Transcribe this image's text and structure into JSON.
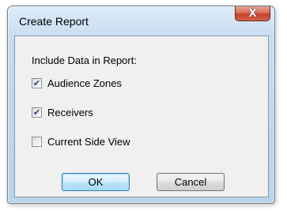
{
  "window": {
    "title": "Create Report",
    "close_symbol": "X"
  },
  "report": {
    "section_label": "Include Data in Report:",
    "options": [
      {
        "label": "Audience Zones",
        "checked": true
      },
      {
        "label": "Receivers",
        "checked": true
      },
      {
        "label": "Current Side View",
        "checked": false
      }
    ]
  },
  "buttons": {
    "ok_label": "OK",
    "cancel_label": "Cancel"
  },
  "icons": {
    "close": "close-icon",
    "check": "checkmark-icon"
  },
  "colors": {
    "title_bar": "#c5dcf0",
    "close_button": "#c5432a",
    "client_background": "#f0f0f0",
    "default_button_border": "#3c7fb1"
  }
}
